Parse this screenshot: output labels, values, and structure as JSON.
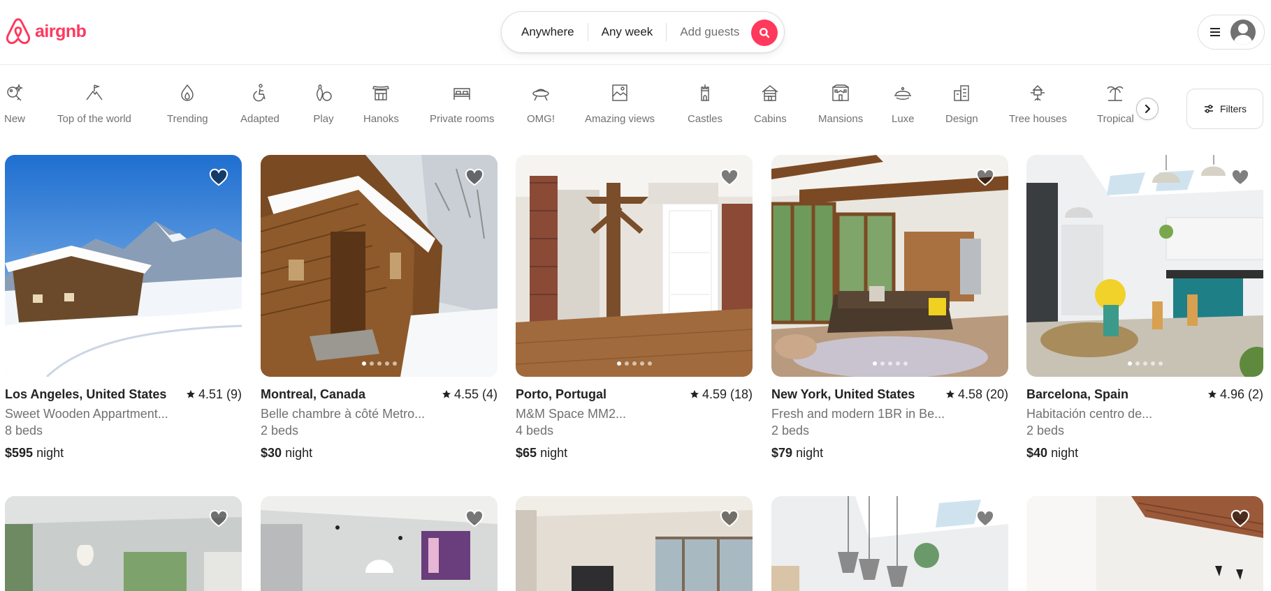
{
  "brand": {
    "name": "airgnb",
    "color": "#ff385c"
  },
  "search": {
    "anywhere": "Anywhere",
    "any_week": "Any week",
    "add_guests": "Add guests",
    "search_icon": "search-icon"
  },
  "user_menu": {
    "menu_icon": "hamburger-icon",
    "avatar_icon": "user-avatar-icon"
  },
  "categories": [
    {
      "label": "New",
      "icon": "key-sparkle-icon"
    },
    {
      "label": "Top of the world",
      "icon": "mountain-flag-icon"
    },
    {
      "label": "Trending",
      "icon": "flame-icon"
    },
    {
      "label": "Adapted",
      "icon": "wheelchair-icon"
    },
    {
      "label": "Play",
      "icon": "bowling-icon"
    },
    {
      "label": "Hanoks",
      "icon": "hanok-icon"
    },
    {
      "label": "Private rooms",
      "icon": "bed-icon"
    },
    {
      "label": "OMG!",
      "icon": "ufo-icon"
    },
    {
      "label": "Amazing views",
      "icon": "picture-frame-icon"
    },
    {
      "label": "Castles",
      "icon": "castle-icon"
    },
    {
      "label": "Cabins",
      "icon": "cabin-icon"
    },
    {
      "label": "Mansions",
      "icon": "mansion-icon"
    },
    {
      "label": "Luxe",
      "icon": "cloche-icon"
    },
    {
      "label": "Design",
      "icon": "building-icon"
    },
    {
      "label": "Tree houses",
      "icon": "treehouse-icon"
    },
    {
      "label": "Tropical",
      "icon": "palm-tree-icon"
    }
  ],
  "filters_label": "Filters",
  "listings": [
    {
      "location": "Los Angeles, United States",
      "rating": "4.51 (9)",
      "title": "Sweet Wooden Appartment...",
      "beds": "8 beds",
      "price": "$595",
      "unit": "night"
    },
    {
      "location": "Montreal, Canada",
      "rating": "4.55 (4)",
      "title": "Belle chambre à côté Metro...",
      "beds": "2 beds",
      "price": "$30",
      "unit": "night"
    },
    {
      "location": "Porto, Portugal",
      "rating": "4.59 (18)",
      "title": "M&M Space MM2...",
      "beds": "4 beds",
      "price": "$65",
      "unit": "night"
    },
    {
      "location": "New York, United States",
      "rating": "4.58 (20)",
      "title": "Fresh and modern 1BR in Be...",
      "beds": "2 beds",
      "price": "$79",
      "unit": "night"
    },
    {
      "location": "Barcelona, Spain",
      "rating": "4.96 (2)",
      "title": "Habitación centro de...",
      "beds": "2 beds",
      "price": "$40",
      "unit": "night"
    }
  ]
}
